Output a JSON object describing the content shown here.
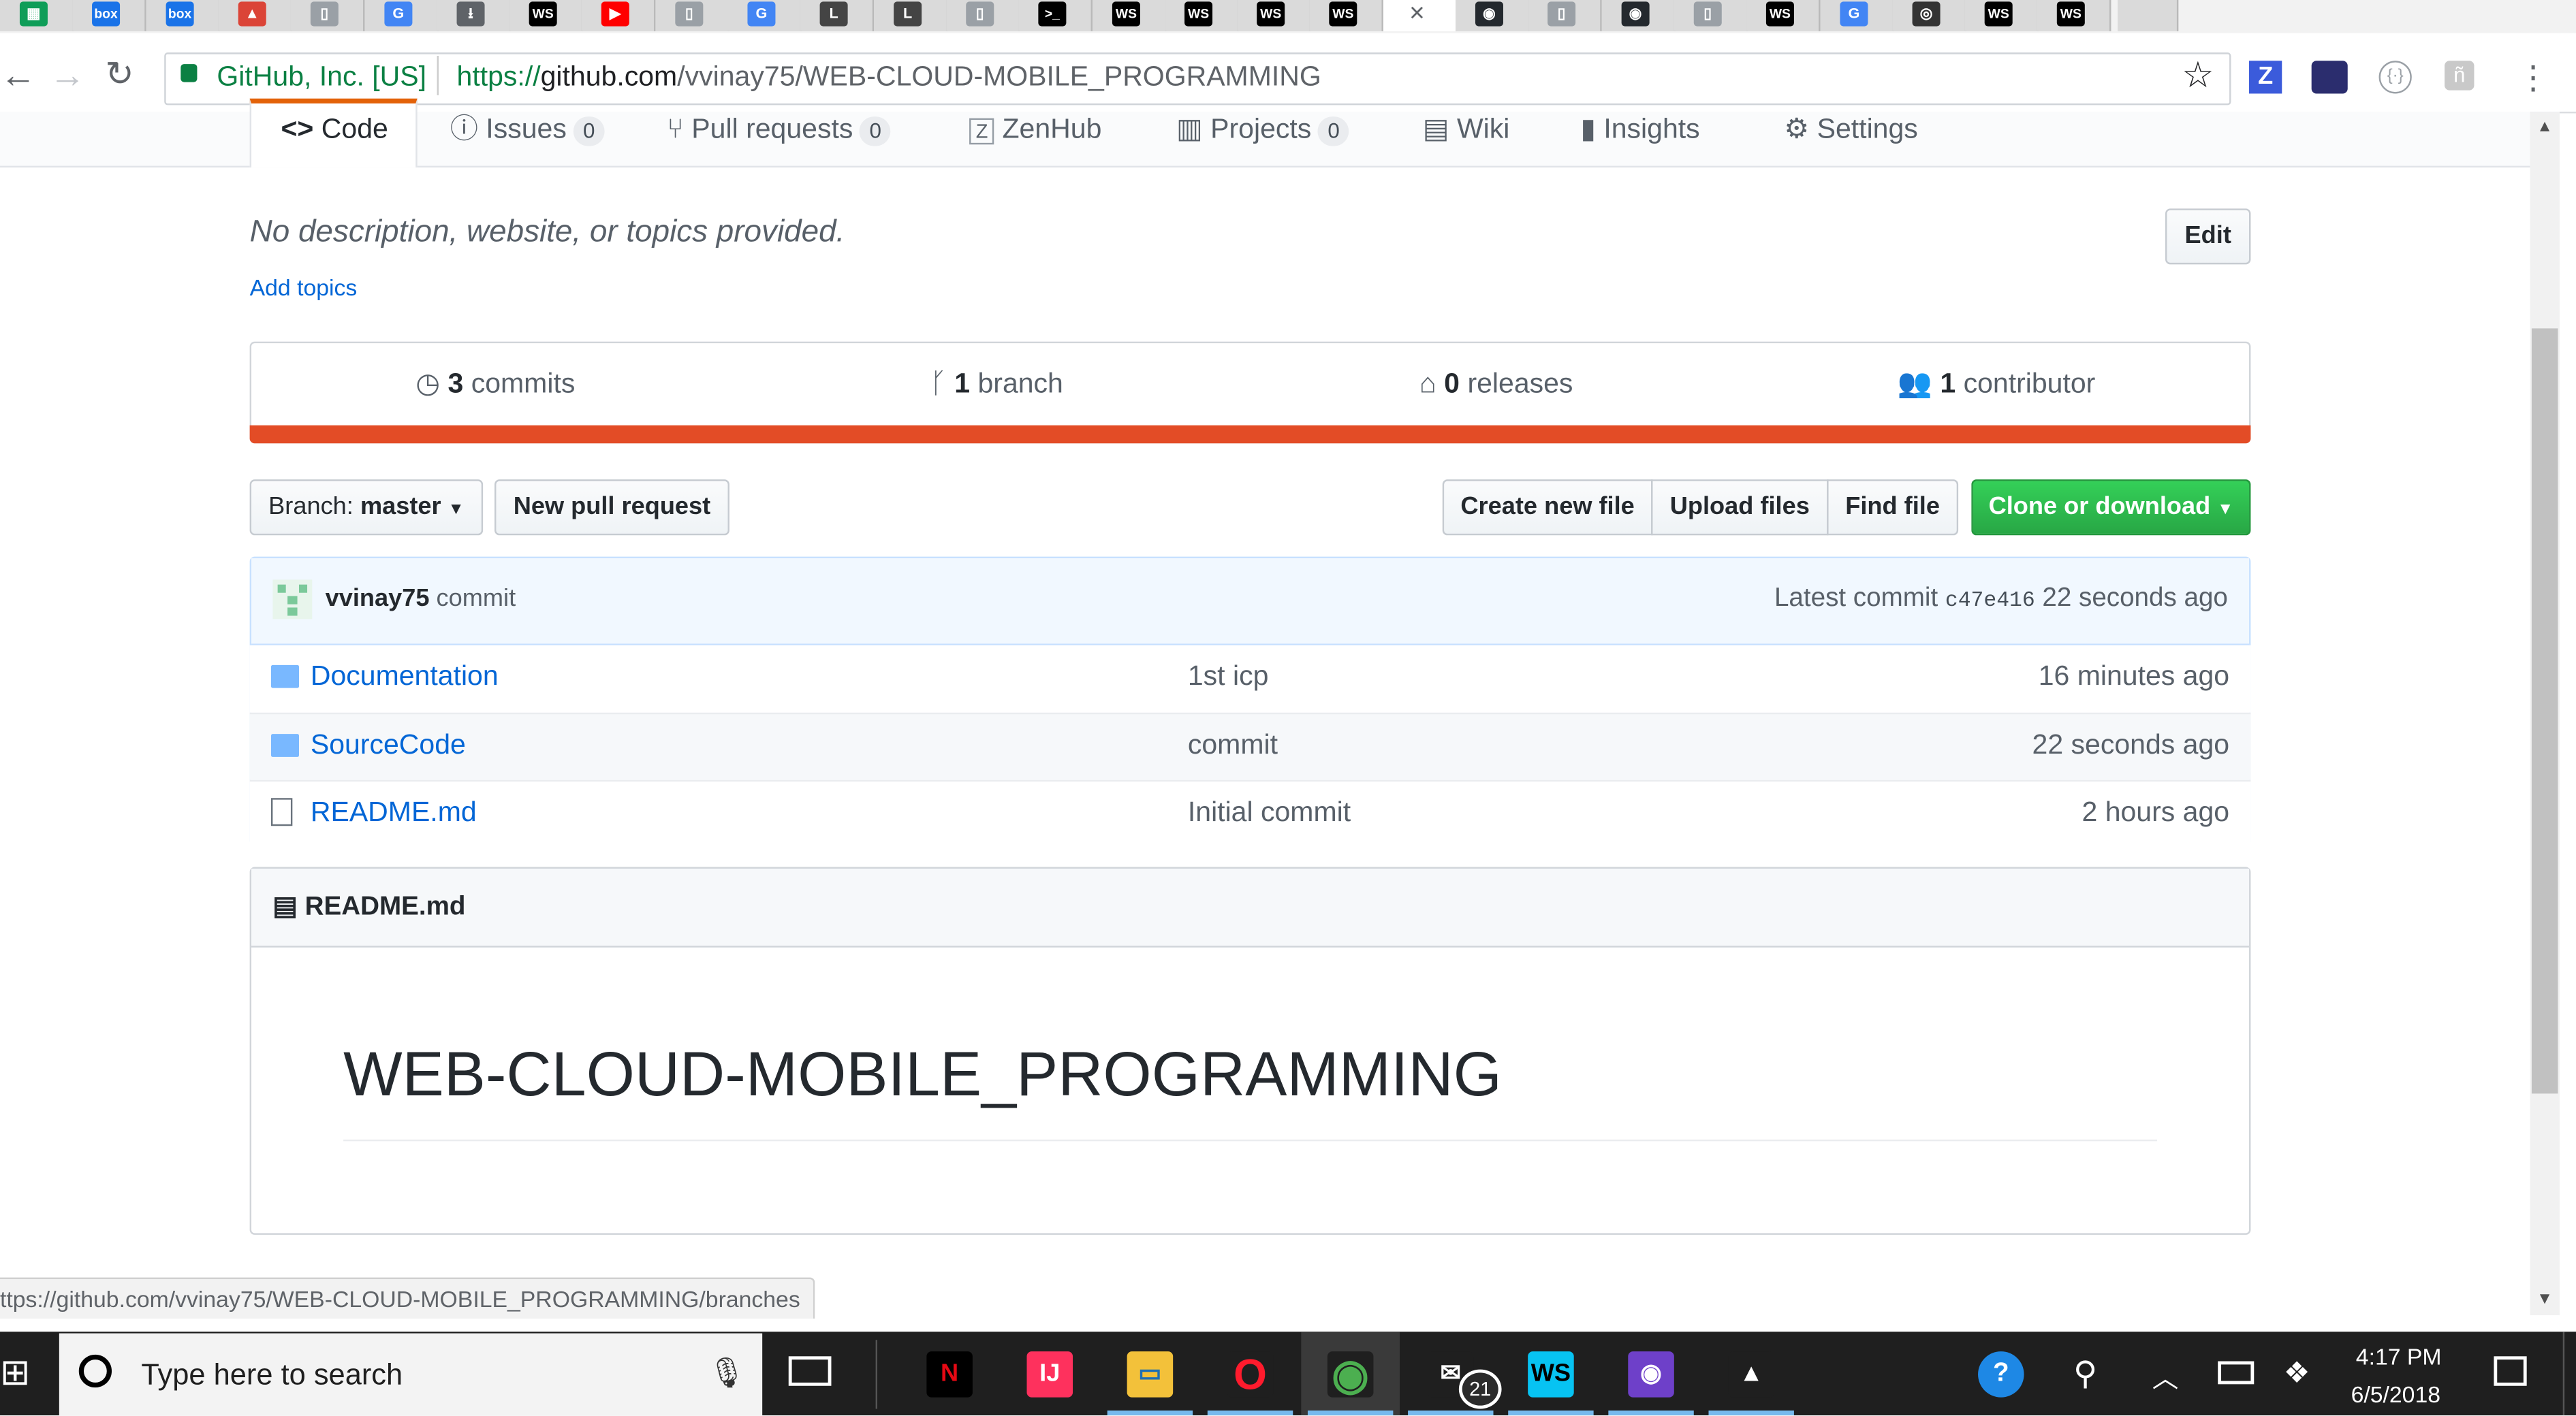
{
  "browser": {
    "tabs": [
      {
        "favicon": "sheets-icon",
        "color": "#0f9d58",
        "glyph": "▦"
      },
      {
        "favicon": "box-icon",
        "color": "#1a73e8",
        "glyph": "box"
      },
      {
        "favicon": "box-icon",
        "color": "#1a73e8",
        "glyph": "box"
      },
      {
        "favicon": "image-icon",
        "color": "#db4437",
        "glyph": "▲"
      },
      {
        "favicon": "page-icon",
        "color": "#9aa0a6",
        "glyph": "▯"
      },
      {
        "favicon": "google-icon",
        "color": "#4285f4",
        "glyph": "G"
      },
      {
        "favicon": "download-icon",
        "color": "#5f6368",
        "glyph": "⭳"
      },
      {
        "favicon": "webstorm-icon",
        "color": "#000000",
        "glyph": "WS"
      },
      {
        "favicon": "youtube-icon",
        "color": "#ff0000",
        "glyph": "▶"
      },
      {
        "favicon": "page-icon",
        "color": "#9aa0a6",
        "glyph": "▯"
      },
      {
        "favicon": "google-icon",
        "color": "#4285f4",
        "glyph": "G"
      },
      {
        "favicon": "lucid-icon",
        "color": "#444444",
        "glyph": "L"
      },
      {
        "favicon": "lucid-icon",
        "color": "#444444",
        "glyph": "L"
      },
      {
        "favicon": "page-icon",
        "color": "#9aa0a6",
        "glyph": "▯"
      },
      {
        "favicon": "terminal-icon",
        "color": "#000000",
        "glyph": ">_"
      },
      {
        "favicon": "webstorm-icon",
        "color": "#000000",
        "glyph": "WS"
      },
      {
        "favicon": "webstorm-icon",
        "color": "#000000",
        "glyph": "WS"
      },
      {
        "favicon": "webstorm-icon",
        "color": "#000000",
        "glyph": "WS"
      },
      {
        "favicon": "webstorm-icon",
        "color": "#000000",
        "glyph": "WS"
      },
      {
        "favicon": "close-icon",
        "color": "#ffffff",
        "glyph": "×",
        "active": true
      },
      {
        "favicon": "github-icon",
        "color": "#24292e",
        "glyph": "◉"
      },
      {
        "favicon": "page-icon",
        "color": "#9aa0a6",
        "glyph": "▯"
      },
      {
        "favicon": "github-icon",
        "color": "#24292e",
        "glyph": "◉"
      },
      {
        "favicon": "page-icon",
        "color": "#9aa0a6",
        "glyph": "▯"
      },
      {
        "favicon": "webstorm-icon",
        "color": "#000000",
        "glyph": "WS"
      },
      {
        "favicon": "google-icon",
        "color": "#4285f4",
        "glyph": "G"
      },
      {
        "favicon": "camera-icon",
        "color": "#333333",
        "glyph": "◎"
      },
      {
        "favicon": "webstorm-icon",
        "color": "#000000",
        "glyph": "WS"
      },
      {
        "favicon": "webstorm-icon",
        "color": "#000000",
        "glyph": "WS"
      }
    ],
    "security_label": "GitHub, Inc. [US]",
    "url_scheme": "https://",
    "url_host": "github.com",
    "url_path": "/vvinay75/WEB-CLOUD-MOBILE_PROGRAMMING",
    "status_url": "ttps://github.com/vvinay75/WEB-CLOUD-MOBILE_PROGRAMMING/branches"
  },
  "repo_nav": {
    "code": "Code",
    "issues": "Issues",
    "issues_count": "0",
    "pulls": "Pull requests",
    "pulls_count": "0",
    "zenhub": "ZenHub",
    "projects": "Projects",
    "projects_count": "0",
    "wiki": "Wiki",
    "insights": "Insights",
    "settings": "Settings"
  },
  "description": {
    "text": "No description, website, or topics provided.",
    "add_topics": "Add topics",
    "edit": "Edit"
  },
  "summary": {
    "commits_count": "3",
    "commits_label": "commits",
    "branch_count": "1",
    "branch_label": "branch",
    "releases_count": "0",
    "releases_label": "releases",
    "contributor_count": "1",
    "contributor_label": "contributor",
    "language_bar_color": "#e34c26"
  },
  "file_nav": {
    "branch_prefix": "Branch:",
    "branch_name": "master",
    "new_pr": "New pull request",
    "create_file": "Create new file",
    "upload_files": "Upload files",
    "find_file": "Find file",
    "clone": "Clone or download"
  },
  "commit_tease": {
    "author": "vvinay75",
    "message": "commit",
    "latest_label": "Latest commit",
    "sha": "c47e416",
    "time": "22 seconds ago"
  },
  "files": [
    {
      "name": "Documentation",
      "message": "1st icp",
      "age": "16 minutes ago",
      "type": "folder"
    },
    {
      "name": "SourceCode",
      "message": "commit",
      "age": "22 seconds ago",
      "type": "folder"
    },
    {
      "name": "README.md",
      "message": "Initial commit",
      "age": "2 hours ago",
      "type": "file"
    }
  ],
  "readme": {
    "header": "README.md",
    "heading": "WEB-CLOUD-MOBILE_PROGRAMMING"
  },
  "taskbar": {
    "search_placeholder": "Type here to search",
    "time": "4:17 PM",
    "date": "6/5/2018",
    "mail_badge": "21",
    "apps": [
      {
        "name": "netflix-icon",
        "color": "#000000",
        "glyph": "N",
        "fg": "#e50914"
      },
      {
        "name": "intellij-icon",
        "color": "#fe315d",
        "glyph": "IJ",
        "fg": "#ffffff"
      },
      {
        "name": "file-explorer-icon",
        "color": "#f3c13a",
        "glyph": "▭",
        "fg": "#1f6fb2"
      },
      {
        "name": "opera-icon",
        "color": "#1f1f1f",
        "glyph": "O",
        "fg": "#ff1b2d"
      },
      {
        "name": "chrome-icon",
        "color": "#1f1f1f",
        "glyph": "◉",
        "fg": "#4caf50"
      },
      {
        "name": "mail-icon",
        "color": "#1f1f1f",
        "glyph": "✉",
        "fg": "#ffffff"
      },
      {
        "name": "webstorm-icon",
        "color": "#07c3f2",
        "glyph": "WS",
        "fg": "#000000"
      },
      {
        "name": "github-desktop-icon",
        "color": "#6e40c9",
        "glyph": "◉",
        "fg": "#ffffff"
      },
      {
        "name": "photos-icon",
        "color": "#1f1f1f",
        "glyph": "▲",
        "fg": "#ffffff"
      }
    ]
  }
}
